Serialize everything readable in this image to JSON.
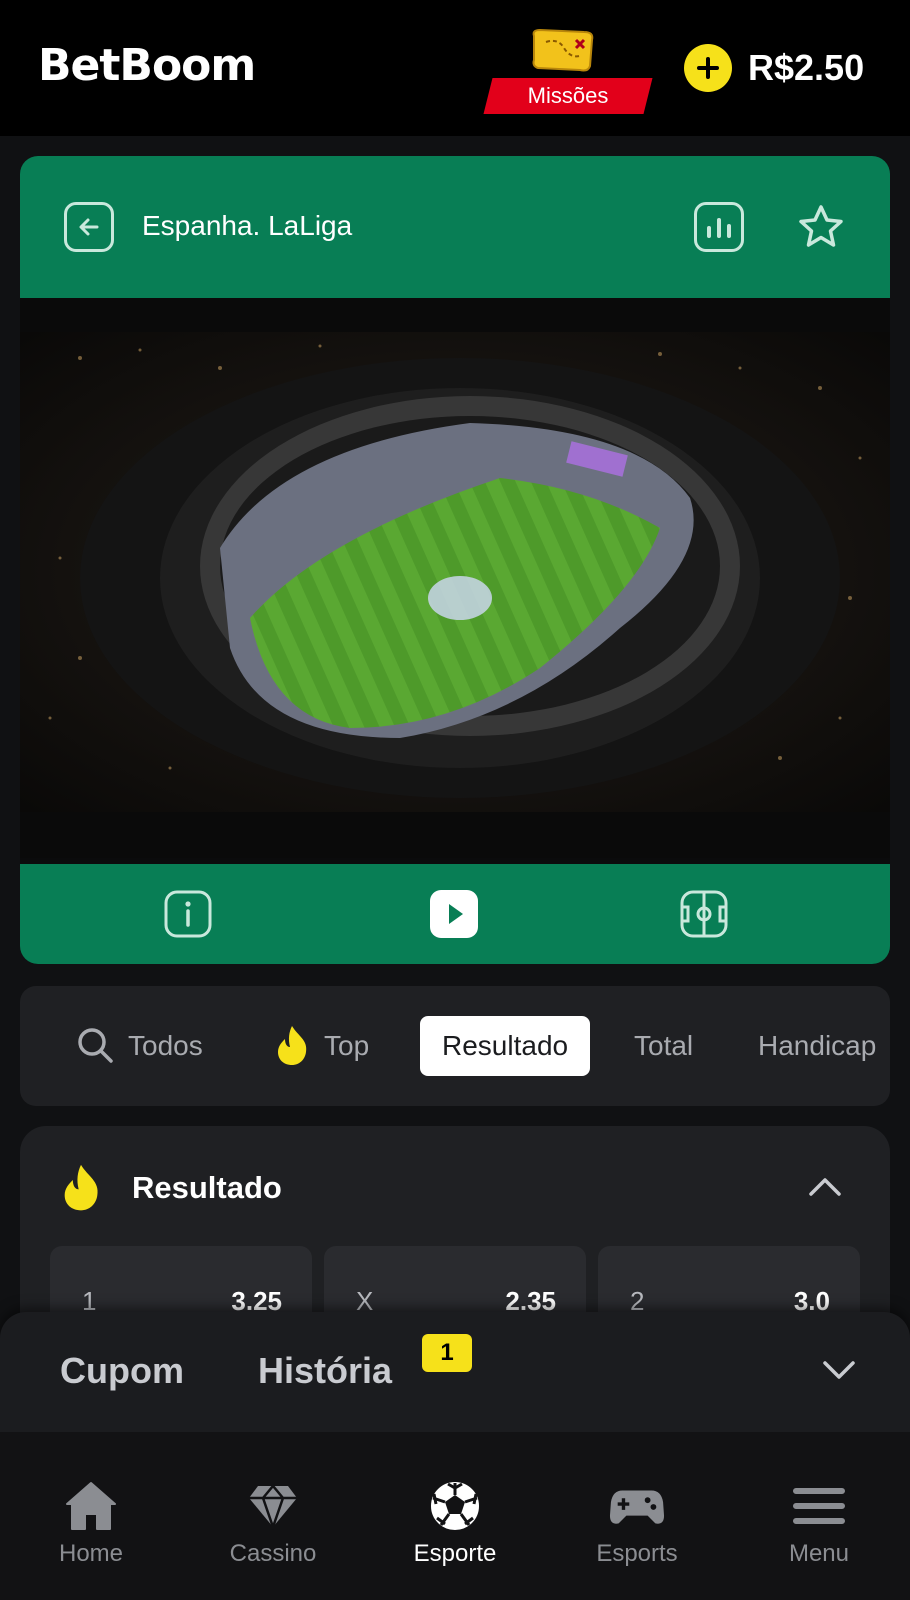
{
  "header": {
    "logo": "BetBoom",
    "missions_label": "Missões",
    "balance": "R$2.50"
  },
  "match": {
    "league": "Espanha. LaLiga",
    "header_color": "#087e55"
  },
  "tabs": [
    {
      "label": "Todos",
      "icon": "search-icon",
      "active": false
    },
    {
      "label": "Top",
      "icon": "flame-icon",
      "active": false
    },
    {
      "label": "Resultado",
      "active": true
    },
    {
      "label": "Total",
      "active": false
    },
    {
      "label": "Handicap",
      "active": false
    }
  ],
  "market": {
    "title": "Resultado",
    "odds": [
      {
        "label": "1",
        "value": "3.25"
      },
      {
        "label": "X",
        "value": "2.35"
      },
      {
        "label": "2",
        "value": "3.0"
      }
    ]
  },
  "coupon": {
    "tab_coupon": "Cupom",
    "tab_history": "História",
    "history_count": "1"
  },
  "nav": [
    {
      "label": "Home",
      "icon": "home-icon",
      "active": false
    },
    {
      "label": "Cassino",
      "icon": "diamond-icon",
      "active": false
    },
    {
      "label": "Esporte",
      "icon": "soccer-ball-icon",
      "active": true
    },
    {
      "label": "Esports",
      "icon": "gamepad-icon",
      "active": false
    },
    {
      "label": "Menu",
      "icon": "hamburger-icon",
      "active": false
    }
  ],
  "colors": {
    "accent_green": "#087e55",
    "accent_yellow": "#f6e11a",
    "missions_red": "#e2001a"
  }
}
